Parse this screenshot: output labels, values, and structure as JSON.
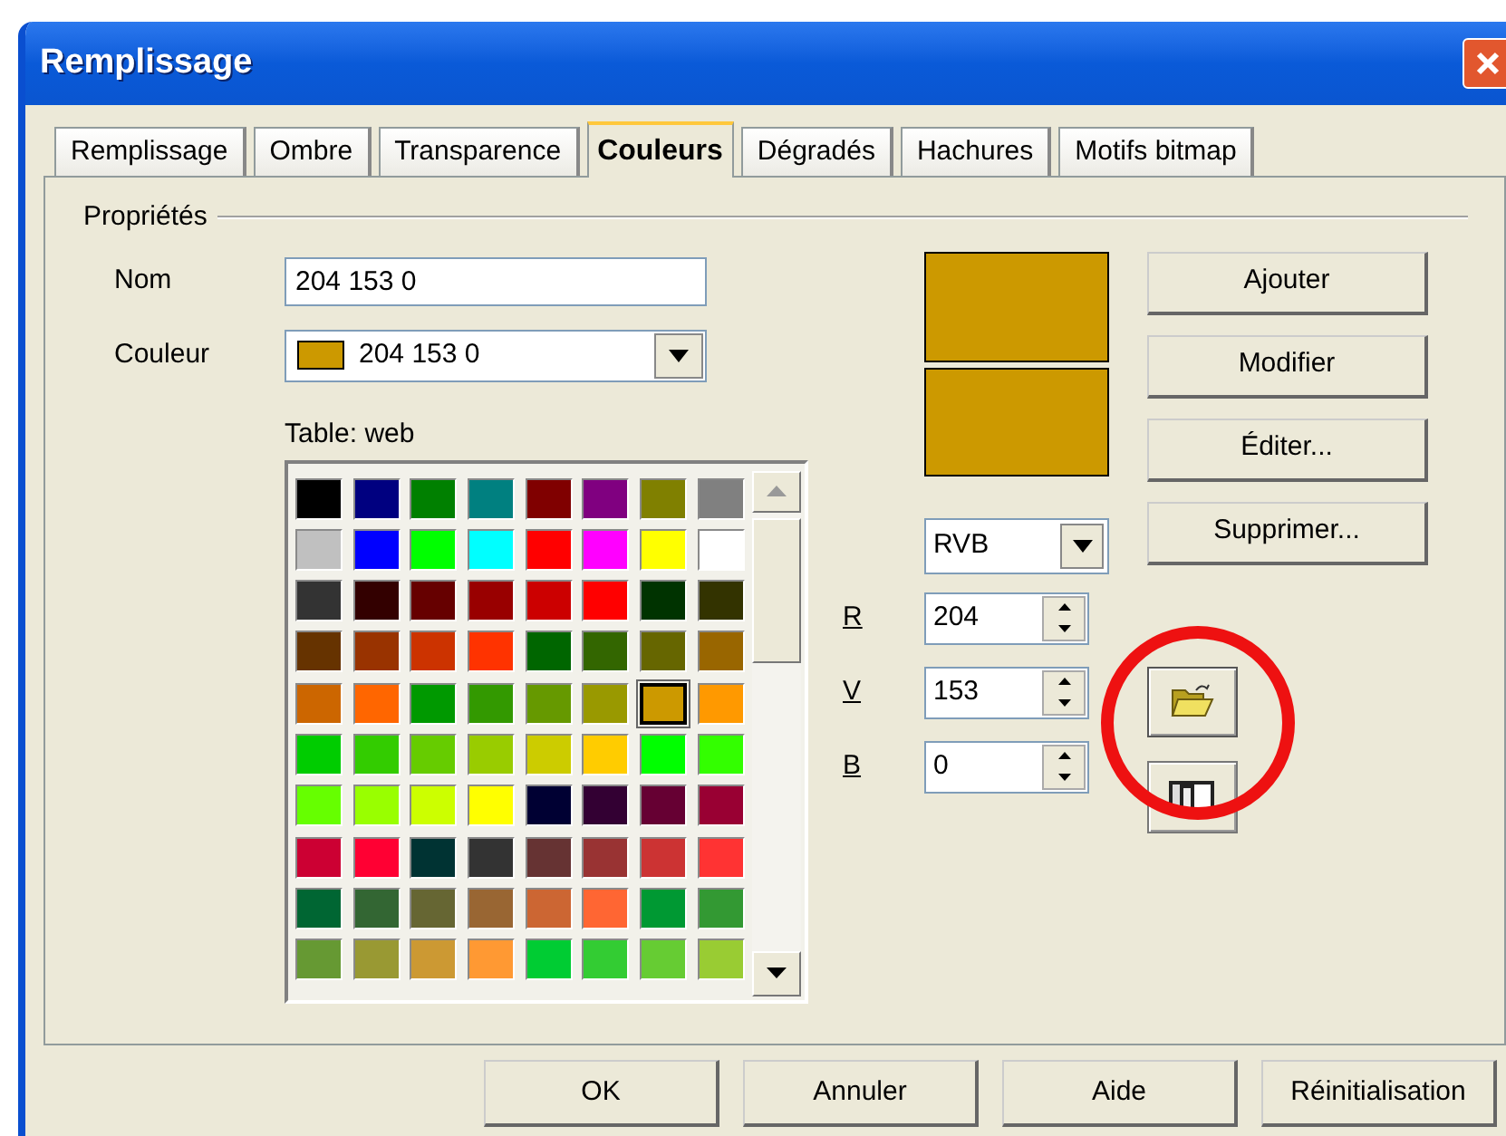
{
  "window": {
    "title": "Remplissage"
  },
  "tabs": [
    {
      "label": "Remplissage",
      "selected": false
    },
    {
      "label": "Ombre",
      "selected": false
    },
    {
      "label": "Transparence",
      "selected": false
    },
    {
      "label": "Couleurs",
      "selected": true
    },
    {
      "label": "Dégradés",
      "selected": false
    },
    {
      "label": "Hachures",
      "selected": false
    },
    {
      "label": "Motifs bitmap",
      "selected": false
    }
  ],
  "properties": {
    "title": "Propriétés",
    "name_label": "Nom",
    "name_value": "204 153 0",
    "color_label": "Couleur",
    "color_value": "204 153 0",
    "table_label": "Table: web"
  },
  "palette": [
    {
      "color": "#000000",
      "selected": false
    },
    {
      "color": "#000080",
      "selected": false
    },
    {
      "color": "#008000",
      "selected": false
    },
    {
      "color": "#008080",
      "selected": false
    },
    {
      "color": "#800000",
      "selected": false
    },
    {
      "color": "#800080",
      "selected": false
    },
    {
      "color": "#808000",
      "selected": false
    },
    {
      "color": "#808080",
      "selected": false
    },
    {
      "color": "#c0c0c0",
      "selected": false
    },
    {
      "color": "#0000ff",
      "selected": false
    },
    {
      "color": "#00ff00",
      "selected": false
    },
    {
      "color": "#00ffff",
      "selected": false
    },
    {
      "color": "#ff0000",
      "selected": false
    },
    {
      "color": "#ff00ff",
      "selected": false
    },
    {
      "color": "#ffff00",
      "selected": false
    },
    {
      "color": "#ffffff",
      "selected": false
    },
    {
      "color": "#333333",
      "selected": false
    },
    {
      "color": "#330000",
      "selected": false
    },
    {
      "color": "#660000",
      "selected": false
    },
    {
      "color": "#990000",
      "selected": false
    },
    {
      "color": "#cc0000",
      "selected": false
    },
    {
      "color": "#ff0000",
      "selected": false
    },
    {
      "color": "#003300",
      "selected": false
    },
    {
      "color": "#333300",
      "selected": false
    },
    {
      "color": "#663300",
      "selected": false
    },
    {
      "color": "#993300",
      "selected": false
    },
    {
      "color": "#cc3300",
      "selected": false
    },
    {
      "color": "#ff3300",
      "selected": false
    },
    {
      "color": "#006600",
      "selected": false
    },
    {
      "color": "#336600",
      "selected": false
    },
    {
      "color": "#666600",
      "selected": false
    },
    {
      "color": "#996600",
      "selected": false
    },
    {
      "color": "#cc6600",
      "selected": false
    },
    {
      "color": "#ff6600",
      "selected": false
    },
    {
      "color": "#009900",
      "selected": false
    },
    {
      "color": "#339900",
      "selected": false
    },
    {
      "color": "#669900",
      "selected": false
    },
    {
      "color": "#999900",
      "selected": false
    },
    {
      "color": "#cc9900",
      "selected": true
    },
    {
      "color": "#ff9900",
      "selected": false
    },
    {
      "color": "#00cc00",
      "selected": false
    },
    {
      "color": "#33cc00",
      "selected": false
    },
    {
      "color": "#66cc00",
      "selected": false
    },
    {
      "color": "#99cc00",
      "selected": false
    },
    {
      "color": "#cccc00",
      "selected": false
    },
    {
      "color": "#ffcc00",
      "selected": false
    },
    {
      "color": "#00ff00",
      "selected": false
    },
    {
      "color": "#33ff00",
      "selected": false
    },
    {
      "color": "#66ff00",
      "selected": false
    },
    {
      "color": "#99ff00",
      "selected": false
    },
    {
      "color": "#ccff00",
      "selected": false
    },
    {
      "color": "#ffff00",
      "selected": false
    },
    {
      "color": "#000033",
      "selected": false
    },
    {
      "color": "#330033",
      "selected": false
    },
    {
      "color": "#660033",
      "selected": false
    },
    {
      "color": "#990033",
      "selected": false
    },
    {
      "color": "#cc0033",
      "selected": false
    },
    {
      "color": "#ff0033",
      "selected": false
    },
    {
      "color": "#003333",
      "selected": false
    },
    {
      "color": "#333333",
      "selected": false
    },
    {
      "color": "#663333",
      "selected": false
    },
    {
      "color": "#993333",
      "selected": false
    },
    {
      "color": "#cc3333",
      "selected": false
    },
    {
      "color": "#ff3333",
      "selected": false
    },
    {
      "color": "#006633",
      "selected": false
    },
    {
      "color": "#336633",
      "selected": false
    },
    {
      "color": "#666633",
      "selected": false
    },
    {
      "color": "#996633",
      "selected": false
    },
    {
      "color": "#cc6633",
      "selected": false
    },
    {
      "color": "#ff6633",
      "selected": false
    },
    {
      "color": "#009933",
      "selected": false
    },
    {
      "color": "#339933",
      "selected": false
    },
    {
      "color": "#669933",
      "selected": false
    },
    {
      "color": "#999933",
      "selected": false
    },
    {
      "color": "#cc9933",
      "selected": false
    },
    {
      "color": "#ff9933",
      "selected": false
    },
    {
      "color": "#00cc33",
      "selected": false
    },
    {
      "color": "#33cc33",
      "selected": false
    },
    {
      "color": "#66cc33",
      "selected": false
    },
    {
      "color": "#99cc33",
      "selected": false
    }
  ],
  "model": {
    "value": "RVB"
  },
  "channels": [
    {
      "label": "R",
      "value": "204"
    },
    {
      "label": "V",
      "value": "153"
    },
    {
      "label": "B",
      "value": "0"
    }
  ],
  "actions": [
    "Ajouter",
    "Modifier",
    "Éditer...",
    "Supprimer..."
  ],
  "footer_buttons": [
    "OK",
    "Annuler",
    "Aide",
    "Réinitialisation"
  ]
}
